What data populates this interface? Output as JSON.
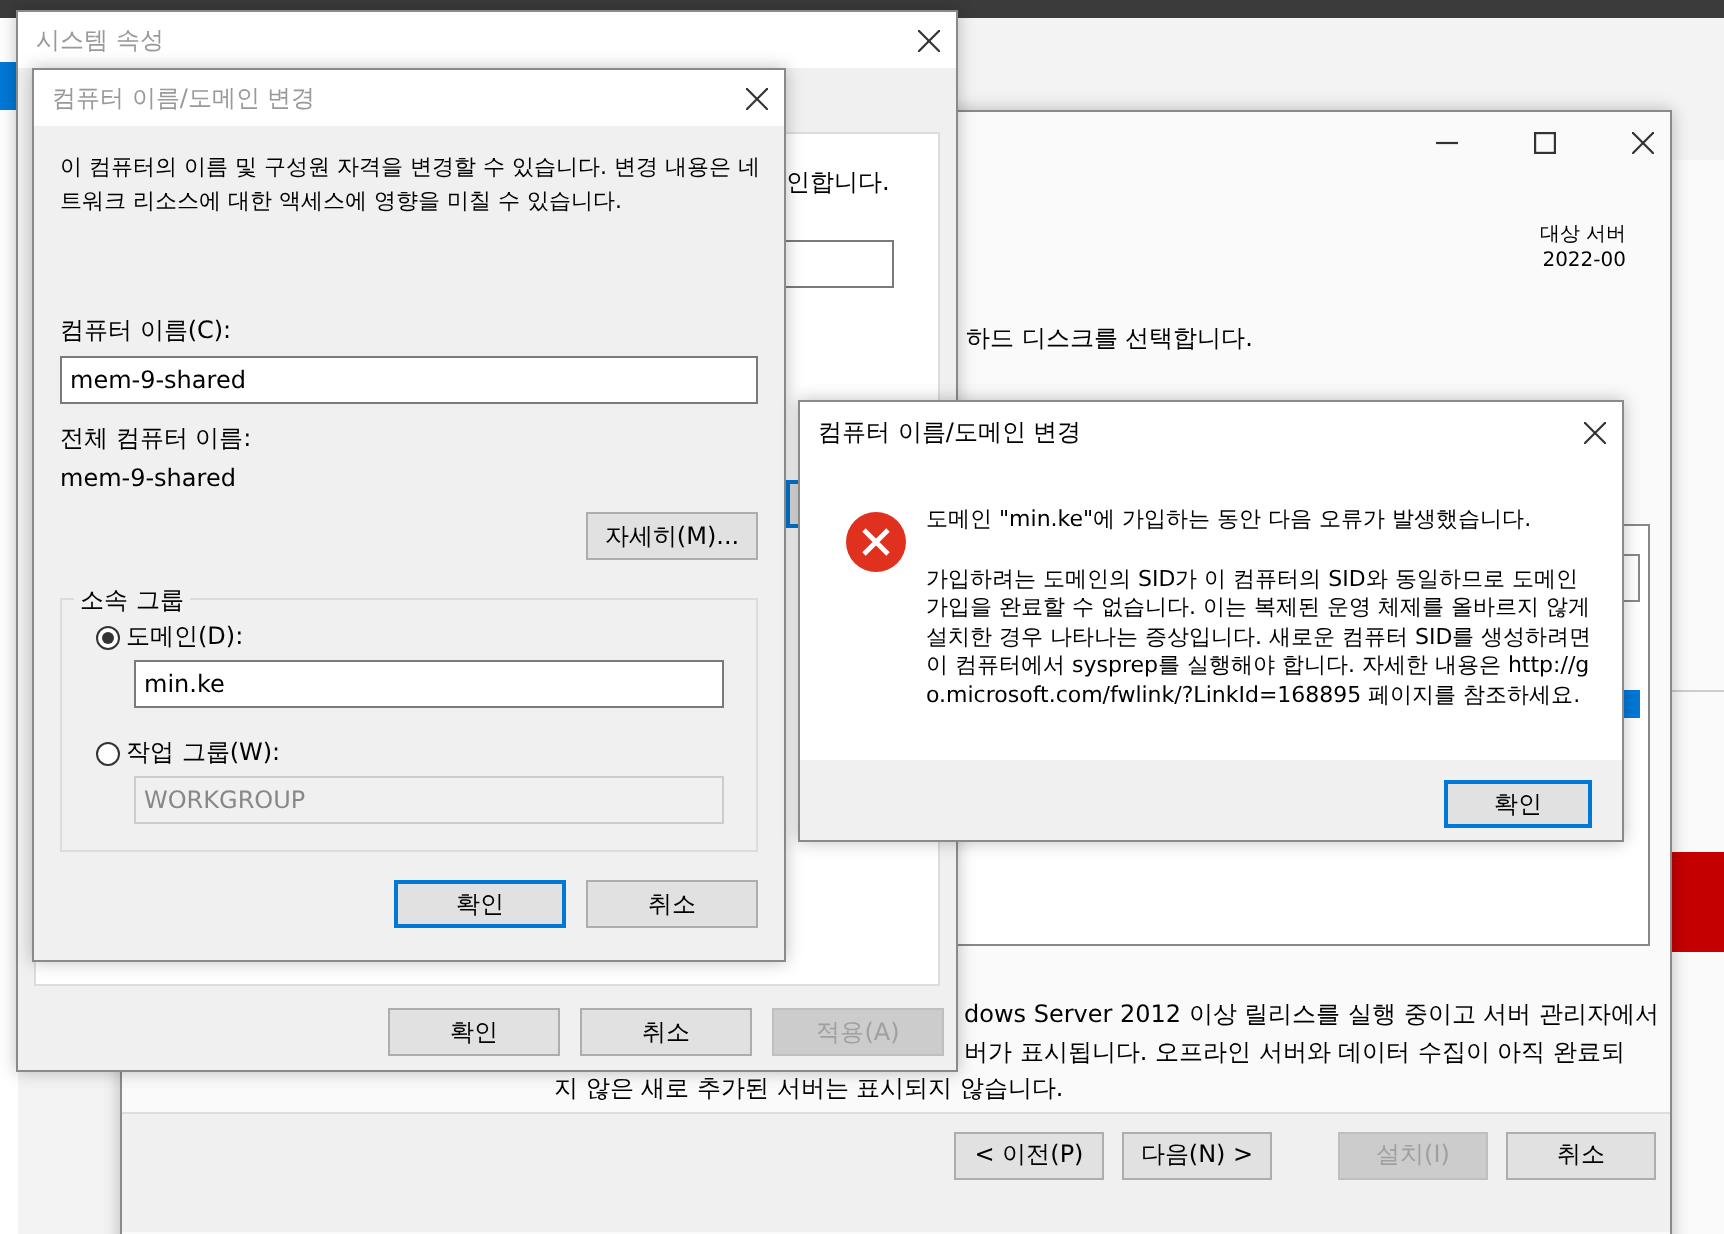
{
  "wizard": {
    "target_server_label": "대상 서버",
    "target_server_value": "2022-00",
    "disk_prompt": "하드 디스크를 선택합니다.",
    "note_lines": [
      "dows Server 2012 이상 릴리스를 실행 중이고 서버 관리자에서",
      "버가 표시됩니다. 오프라인 서버와 데이터 수집이 아직 완료되",
      "지 않은 새로 추가된 서버는 표시되지 않습니다."
    ],
    "buttons": [
      {
        "label": "< 이전(P)",
        "disabled": false
      },
      {
        "label": "다음(N) >",
        "disabled": false
      },
      {
        "label": "설치(I)",
        "disabled": true
      },
      {
        "label": "취소",
        "disabled": false
      }
    ]
  },
  "system_properties": {
    "title": "시스템 속성",
    "active": false,
    "fragment_text": "인합니다.",
    "buttons": [
      {
        "label": "확인",
        "disabled": false
      },
      {
        "label": "취소",
        "disabled": false
      },
      {
        "label": "적용(A)",
        "disabled": true
      }
    ]
  },
  "name_dialog": {
    "title": "컴퓨터 이름/도메인 변경",
    "active": false,
    "description": "이 컴퓨터의 이름 및 구성원 자격을 변경할 수 있습니다. 변경 내용은 네트워크 리소스에 대한 액세스에 영향을 미칠 수 있습니다.",
    "computer_name": {
      "label": "컴퓨터 이름(C):",
      "value": "mem-9-shared"
    },
    "full_name": {
      "label": "전체 컴퓨터 이름:",
      "value": "mem-9-shared"
    },
    "more_button": "자세히(M)...",
    "member_of": {
      "legend": "소속 그룹",
      "options": [
        {
          "label": "도메인(D):",
          "selected": true,
          "value": "min.ke"
        },
        {
          "label": "작업 그룹(W):",
          "selected": false,
          "value": "WORKGROUP"
        }
      ]
    },
    "buttons": [
      {
        "label": "확인",
        "default": true
      },
      {
        "label": "취소",
        "default": false
      }
    ]
  },
  "error_dialog": {
    "title": "컴퓨터 이름/도메인 변경",
    "active": true,
    "message": "도메인 \"min.ke\"에 가입하는 동안 다음 오류가 발생했습니다.",
    "details": "가입하려는 도메인의 SID가 이 컴퓨터의 SID와 동일하므로 도메인 가입을 완료할 수 없습니다. 이는 복제된 운영 체제를 올바르지 않게 설치한 경우 나타나는 증상입니다. 새로운 컴퓨터 SID를 생성하려면 이 컴퓨터에서 sysprep를 실행해야 합니다. 자세한 내용은 http://go.microsoft.com/fwlink/?LinkId=168895 페이지를 참조하세요.",
    "buttons": [
      {
        "label": "확인",
        "default": true
      }
    ]
  }
}
